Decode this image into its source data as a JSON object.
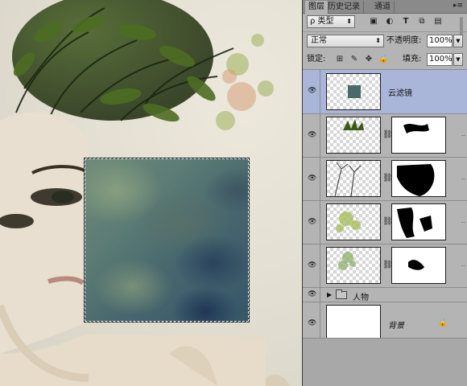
{
  "panel": {
    "tabs": [
      {
        "label": "图层",
        "active": true
      },
      {
        "label": "历史记录",
        "active": false
      },
      {
        "label": "通道",
        "active": false
      }
    ],
    "menu_glyph": "▸≡"
  },
  "filter": {
    "search_glyph": "ρ",
    "kind_label": "类型",
    "icons": [
      "image-filter-icon",
      "adjustment-filter-icon",
      "text-filter-icon",
      "shape-filter-icon",
      "smart-object-filter-icon"
    ]
  },
  "blend": {
    "mode": "正常",
    "opacity_label": "不透明度:",
    "opacity_value": "100%"
  },
  "lock": {
    "label": "锁定:",
    "fill_label": "填充:",
    "fill_value": "100%"
  },
  "layers": [
    {
      "name": "云滤镜",
      "selected": true,
      "type": "pixel"
    },
    {
      "name": "",
      "selected": false,
      "type": "masked"
    },
    {
      "name": "",
      "selected": false,
      "type": "masked"
    },
    {
      "name": "",
      "selected": false,
      "type": "masked"
    },
    {
      "name": "",
      "selected": false,
      "type": "masked"
    },
    {
      "name": "人物",
      "selected": false,
      "type": "group"
    },
    {
      "name": "背景",
      "selected": false,
      "type": "background",
      "locked": true
    }
  ],
  "colors": {
    "panel_bg": "#b4b4b4",
    "selected_layer": "#a9b6d9",
    "cloud_dark": "#36566a",
    "cloud_light": "#8ca280"
  }
}
